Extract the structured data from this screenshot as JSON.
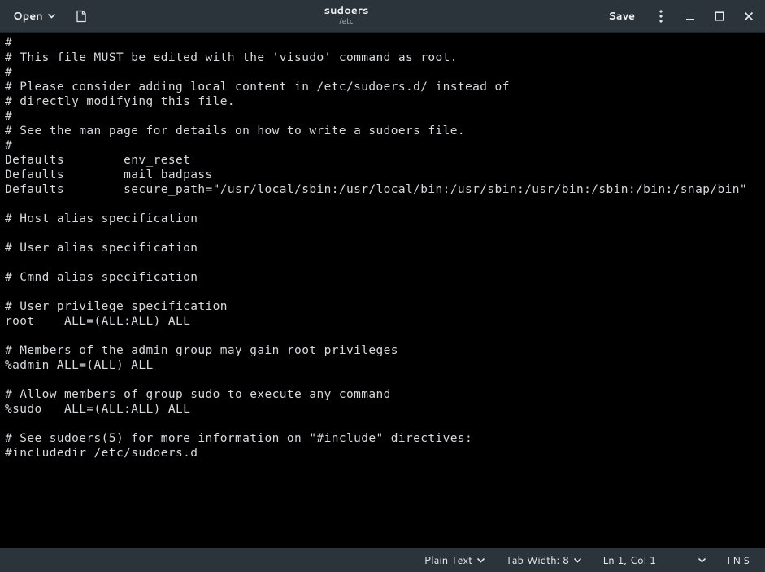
{
  "header": {
    "open_label": "Open",
    "title": "sudoers",
    "subtitle": "/etc",
    "save_label": "Save"
  },
  "editor": {
    "content": "#\n# This file MUST be edited with the 'visudo' command as root.\n#\n# Please consider adding local content in /etc/sudoers.d/ instead of\n# directly modifying this file.\n#\n# See the man page for details on how to write a sudoers file.\n#\nDefaults        env_reset\nDefaults        mail_badpass\nDefaults        secure_path=\"/usr/local/sbin:/usr/local/bin:/usr/sbin:/usr/bin:/sbin:/bin:/snap/bin\"\n\n# Host alias specification\n\n# User alias specification\n\n# Cmnd alias specification\n\n# User privilege specification\nroot    ALL=(ALL:ALL) ALL\n\n# Members of the admin group may gain root privileges\n%admin ALL=(ALL) ALL\n\n# Allow members of group sudo to execute any command\n%sudo   ALL=(ALL:ALL) ALL\n\n# See sudoers(5) for more information on \"#include\" directives:\n#includedir /etc/sudoers.d"
  },
  "status": {
    "syntax": "Plain Text",
    "tab_width": "Tab Width: 8",
    "cursor": "Ln 1, Col 1",
    "insert_mode": "INS"
  }
}
